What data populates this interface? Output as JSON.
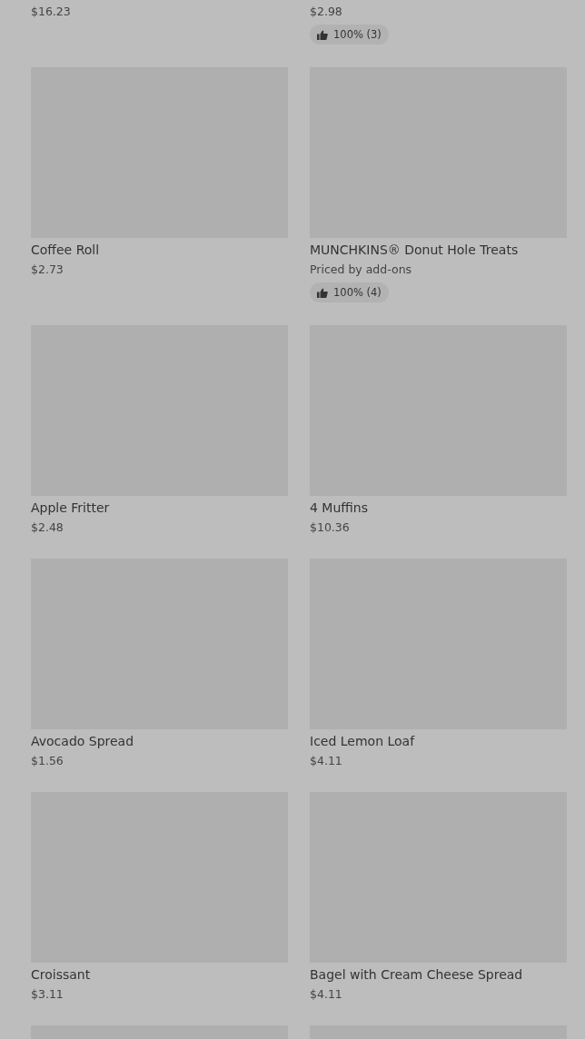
{
  "items": [
    {
      "price": "$16.23"
    },
    {
      "price": "$2.98",
      "rating": "100% (3)"
    },
    {
      "name": "Coffee Roll",
      "price": "$2.73",
      "image": {
        "kind": "picture"
      }
    },
    {
      "name": "MUNCHKINS® Donut Hole Treats",
      "price": "Priced by add-ons",
      "rating": "100% (4)",
      "image": {
        "kind": "picture"
      }
    },
    {
      "name": "Apple Fritter",
      "price": "$2.48",
      "image": {
        "kind": "picture"
      }
    },
    {
      "name": "4 Muffins",
      "price": "$10.36",
      "image": {
        "kind": "picture"
      }
    },
    {
      "name": "Avocado Spread",
      "price": "$1.56",
      "image": {
        "kind": "picture"
      }
    },
    {
      "name": "Iced Lemon Loaf",
      "price": "$4.11",
      "image": {
        "kind": "picture"
      }
    },
    {
      "name": "Croissant",
      "price": "$3.11",
      "image": {
        "kind": "picture"
      }
    },
    {
      "name": "Bagel with Cream Cheese Spread",
      "price": "$4.11",
      "image": {
        "kind": "picture"
      }
    },
    {
      "image": {
        "kind": "picture"
      }
    },
    {
      "image": {
        "kind": "picture"
      }
    }
  ]
}
